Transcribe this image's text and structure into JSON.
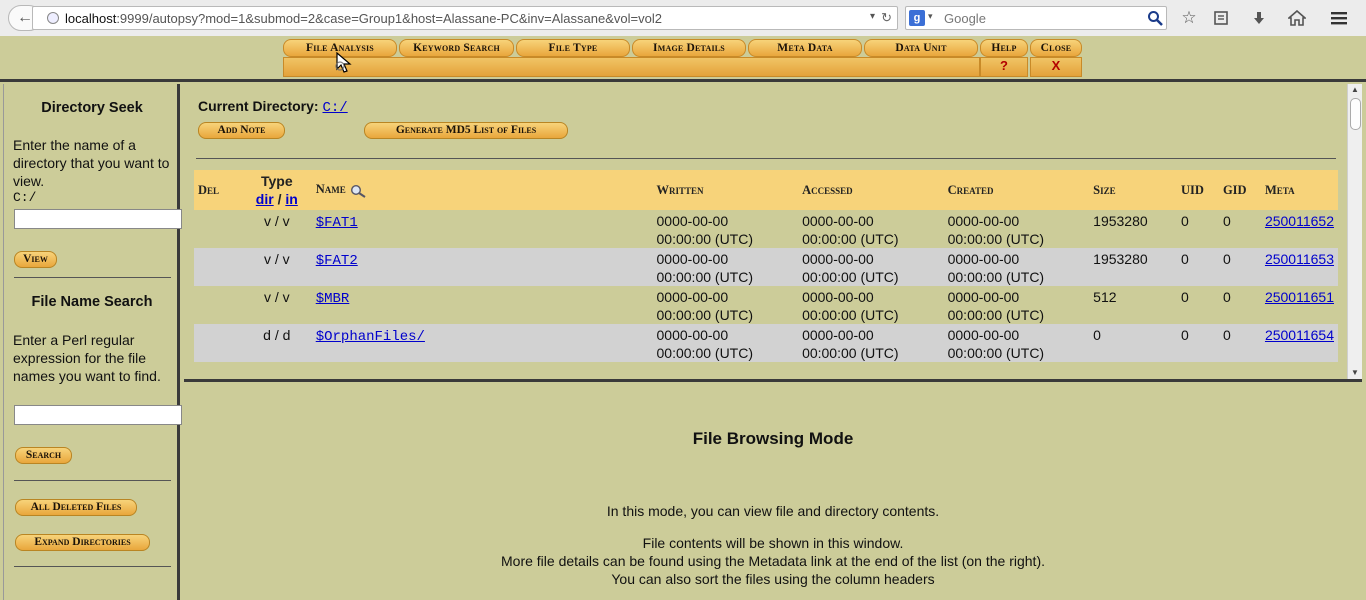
{
  "browser": {
    "url_host": "localhost",
    "url_rest": ":9999/autopsy?mod=1&submod=2&case=Group1&host=Alassane-PC&inv=Alassane&vol=vol2",
    "search_placeholder": "Google"
  },
  "menu": {
    "tabs": [
      "File Analysis",
      "Keyword Search",
      "File Type",
      "Image Details",
      "Meta Data",
      "Data Unit",
      "Help",
      "Close"
    ],
    "help_mark": "?",
    "close_mark": "X"
  },
  "left": {
    "dir_seek_title": "Directory Seek",
    "dir_seek_text": "Enter the name of a directory that you want to view.",
    "dir_seek_value": "C:/",
    "view_button": "View",
    "name_search_title": "File Name Search",
    "name_search_text": "Enter a Perl regular expression for the file names you want to find.",
    "search_button": "Search",
    "all_deleted_button": "All Deleted Files",
    "expand_dirs_button": "Expand Directories"
  },
  "main": {
    "current_dir_label": "Current Directory:",
    "current_dir_link": "C:/",
    "add_note_button": "Add Note",
    "md5_button": "Generate MD5 List of Files",
    "columns": {
      "del": "Del",
      "type": "Type",
      "type_dir": "dir",
      "type_sep": "/",
      "type_in": "in",
      "name": "Name",
      "written": "Written",
      "accessed": "Accessed",
      "created": "Created",
      "size": "Size",
      "uid": "UID",
      "gid": "GID",
      "meta": "Meta"
    },
    "rows": [
      {
        "type": "v / v",
        "name": "$FAT1",
        "written1": "0000-00-00",
        "written2": "00:00:00 (UTC)",
        "accessed1": "0000-00-00",
        "accessed2": "00:00:00 (UTC)",
        "created1": "0000-00-00",
        "created2": "00:00:00 (UTC)",
        "size": "1953280",
        "uid": "0",
        "gid": "0",
        "meta": "250011652"
      },
      {
        "type": "v / v",
        "name": "$FAT2",
        "written1": "0000-00-00",
        "written2": "00:00:00 (UTC)",
        "accessed1": "0000-00-00",
        "accessed2": "00:00:00 (UTC)",
        "created1": "0000-00-00",
        "created2": "00:00:00 (UTC)",
        "size": "1953280",
        "uid": "0",
        "gid": "0",
        "meta": "250011653"
      },
      {
        "type": "v / v",
        "name": "$MBR",
        "written1": "0000-00-00",
        "written2": "00:00:00 (UTC)",
        "accessed1": "0000-00-00",
        "accessed2": "00:00:00 (UTC)",
        "created1": "0000-00-00",
        "created2": "00:00:00 (UTC)",
        "size": "512",
        "uid": "0",
        "gid": "0",
        "meta": "250011651"
      },
      {
        "type": "d / d",
        "name": "$OrphanFiles/",
        "written1": "0000-00-00",
        "written2": "00:00:00 (UTC)",
        "accessed1": "0000-00-00",
        "accessed2": "00:00:00 (UTC)",
        "created1": "0000-00-00",
        "created2": "00:00:00 (UTC)",
        "size": "0",
        "uid": "0",
        "gid": "0",
        "meta": "250011654"
      }
    ]
  },
  "lower": {
    "title": "File Browsing Mode",
    "line1": "In this mode, you can view file and directory contents.",
    "line2": "File contents will be shown in this window.",
    "line3": "More file details can be found using the Metadata link at the end of the list (on the right).",
    "line4": "You can also sort the files using the column headers"
  },
  "colors": {
    "frame_bg": "#cccc99",
    "tab_gold": "#f7d37a",
    "link_blue": "#0000cc"
  }
}
